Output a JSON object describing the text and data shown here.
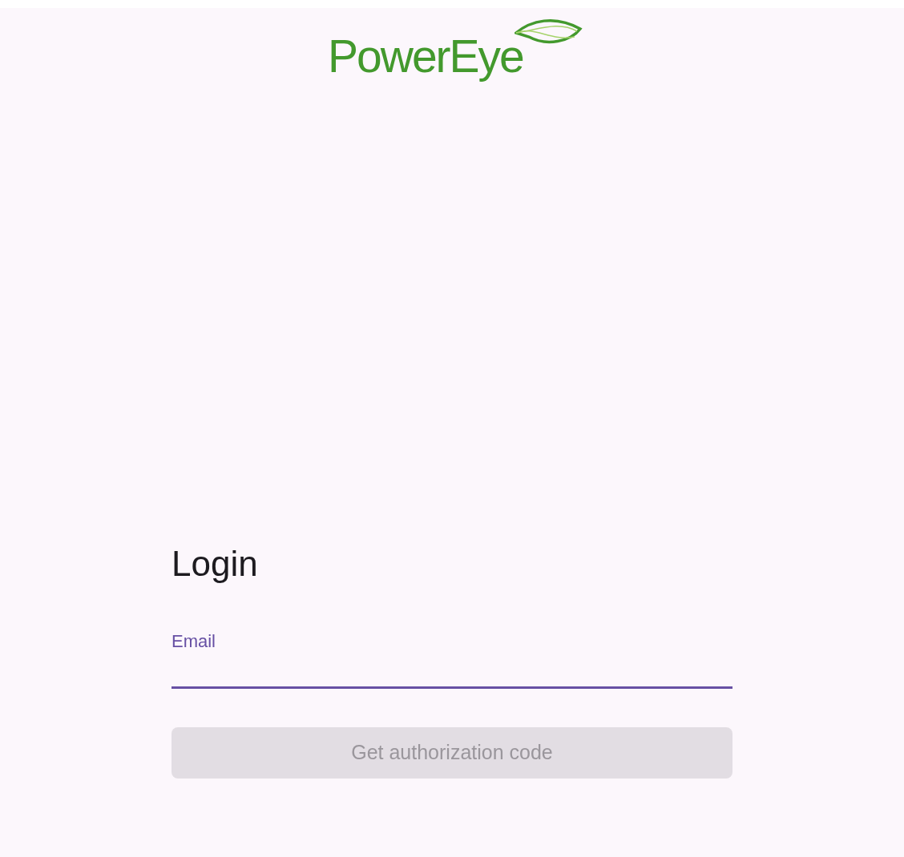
{
  "logo": {
    "text": "PowerEye"
  },
  "login": {
    "title": "Login",
    "email_field": {
      "label": "Email",
      "focused": true
    },
    "submit_button": {
      "label": "Get authorization code",
      "disabled": true
    }
  }
}
